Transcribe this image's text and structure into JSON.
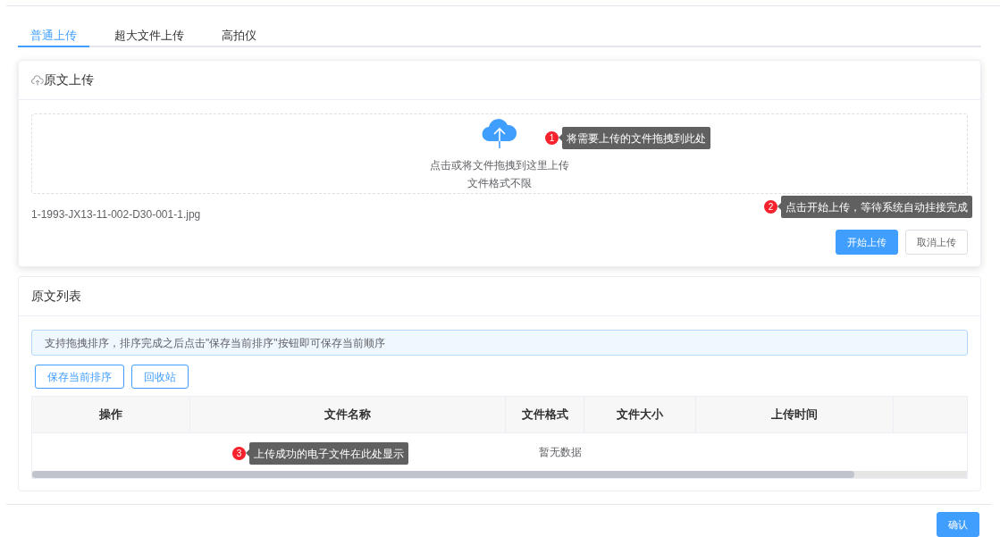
{
  "tabs": [
    {
      "label": "普通上传",
      "selected": true
    },
    {
      "label": "超大文件上传",
      "selected": false
    },
    {
      "label": "高拍仪",
      "selected": false
    }
  ],
  "upload_panel": {
    "title": "原文上传",
    "dropzone": {
      "text": "点击或将文件拖拽到这里上传",
      "hint": "文件格式不限",
      "callout": {
        "number": "1",
        "text": "将需要上传的文件拖拽到此处"
      }
    },
    "file": "1-1993-JX13-11-002-D30-001-1.jpg",
    "callout": {
      "number": "2",
      "text": "点击开始上传，等待系统自动挂接完成"
    },
    "buttons": [
      {
        "label": "开始上传",
        "kind": "primary"
      },
      {
        "label": "取消上传",
        "kind": "default"
      }
    ]
  },
  "list_panel": {
    "title": "原文列表",
    "notice": "支持拖拽排序，排序完成之后点击\"保存当前排序\"按钮即可保存当前顺序",
    "buttons": [
      {
        "label": "保存当前排序",
        "kind": "outline"
      },
      {
        "label": "回收站",
        "kind": "outline"
      }
    ],
    "table": {
      "columns": [
        "操作",
        "文件名称",
        "文件格式",
        "文件大小",
        "上传时间"
      ],
      "empty_text": "暂无数据",
      "callout": {
        "number": "3",
        "text": "上传成功的电子文件在此处显示"
      }
    }
  },
  "footer": {
    "buttons": [
      {
        "label": "确认",
        "kind": "primary"
      }
    ]
  }
}
